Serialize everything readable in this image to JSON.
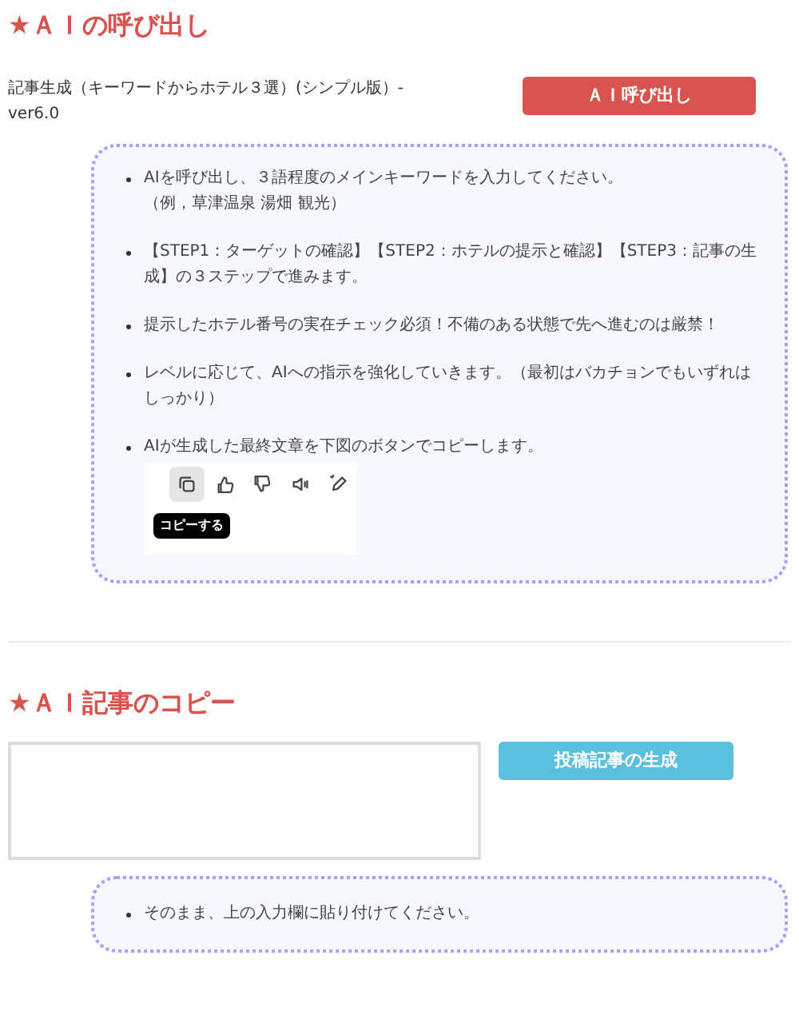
{
  "sections": [
    {
      "heading": "★ＡＩの呼び出し",
      "description": "記事生成（キーワードからホテル３選）(シンプル版）-ver6.0",
      "button": {
        "label": "ＡＩ呼び出し",
        "kind": "danger"
      },
      "notes": [
        {
          "lines": [
            "AIを呼び出し、３語程度のメインキーワードを入力してください。",
            "（例，草津温泉 湯畑 観光）"
          ]
        },
        {
          "lines": [
            "【STEP1：ターゲットの確認】【STEP2：ホテルの提示と確認】【STEP3：記事の生成】の３ステップで進みます。"
          ]
        },
        {
          "lines": [
            "提示したホテル番号の実在チェック必須！不備のある状態で先へ進むのは厳禁！"
          ]
        },
        {
          "lines": [
            "レベルに応じて、AIへの指示を強化していきます。（最初はバカチョンでもいずれはしっかり）"
          ]
        },
        {
          "lines": [
            "AIが生成した最終文章を下図のボタンでコピーします。"
          ],
          "toolbar": {
            "buttons": [
              {
                "kind": "copy",
                "selected": true
              },
              {
                "kind": "like",
                "selected": false
              },
              {
                "kind": "dislike",
                "selected": false
              },
              {
                "kind": "speak",
                "selected": false
              },
              {
                "kind": "edit",
                "selected": false
              }
            ],
            "tooltip": "コピーする"
          }
        }
      ]
    },
    {
      "heading": "★ＡＩ記事のコピー",
      "field": {
        "kind": "textarea"
      },
      "button": {
        "label": "投稿記事の生成",
        "kind": "info"
      },
      "notes": [
        {
          "lines": [
            "そのまま、上の入力欄に貼り付けてください。"
          ]
        }
      ]
    }
  ]
}
